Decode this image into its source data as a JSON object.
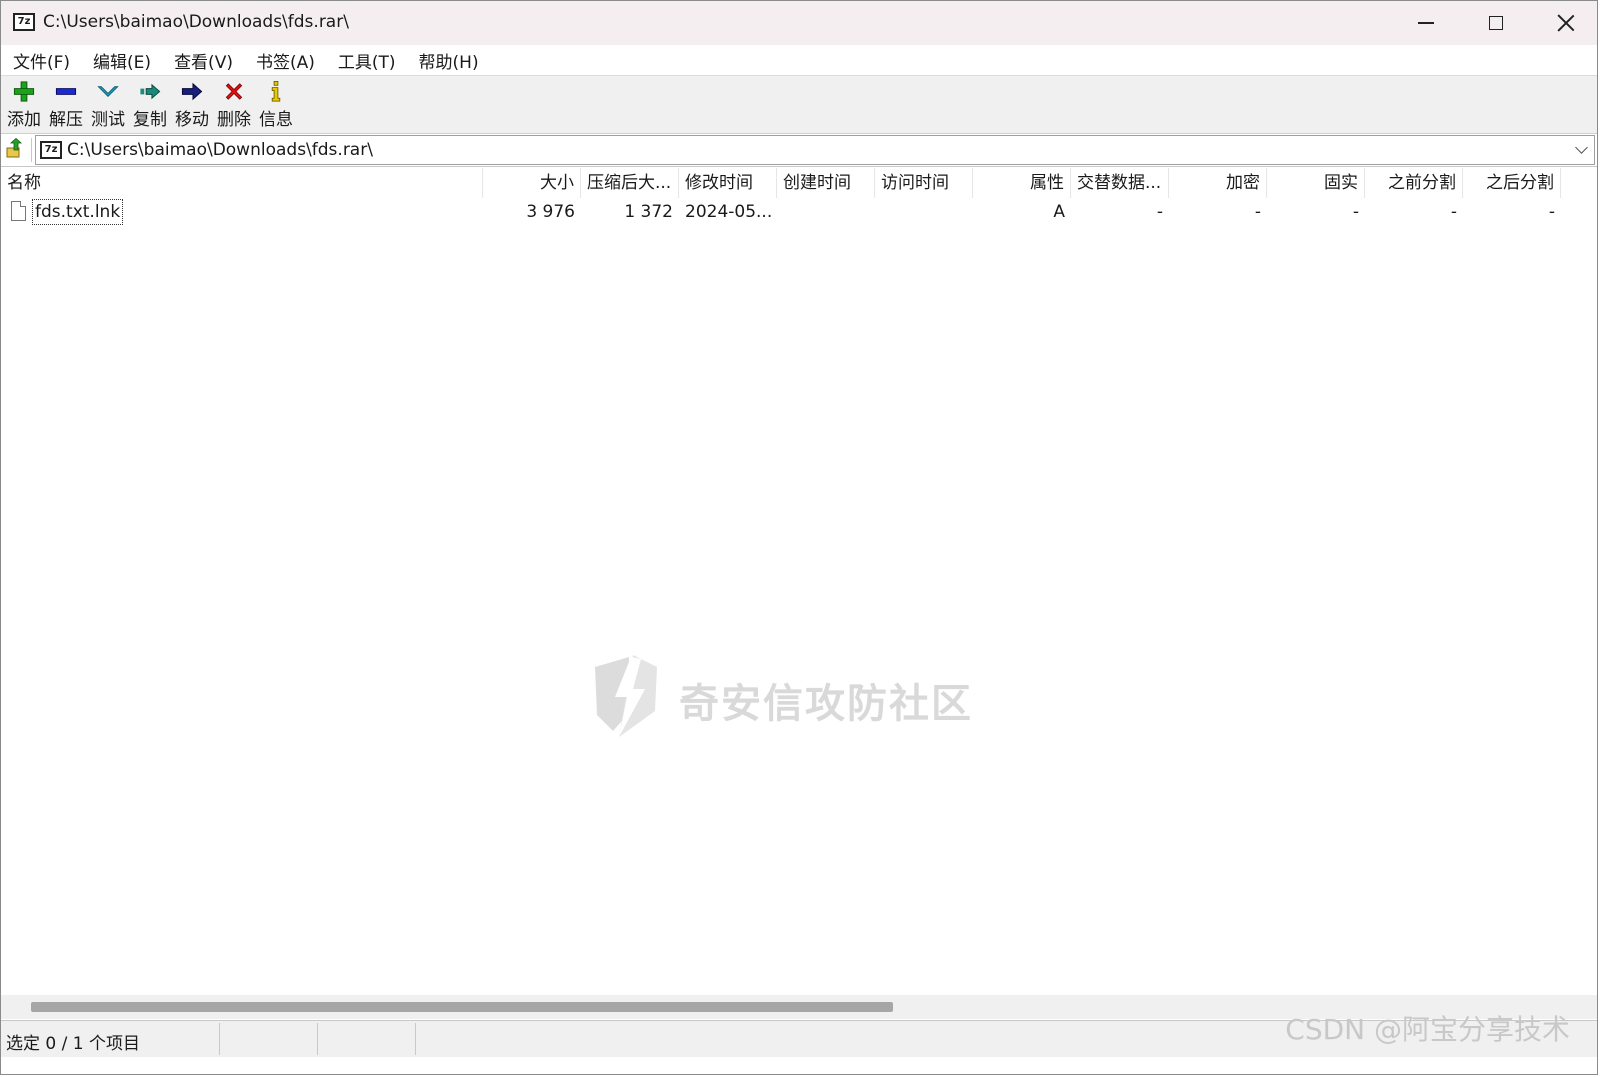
{
  "window": {
    "title": "C:\\Users\\baimao\\Downloads\\fds.rar\\",
    "app_icon_text": "7z"
  },
  "menu": [
    "文件(F)",
    "编辑(E)",
    "查看(V)",
    "书签(A)",
    "工具(T)",
    "帮助(H)"
  ],
  "toolbar": [
    {
      "label": "添加",
      "icon": "add-icon",
      "color": "#1ea21e"
    },
    {
      "label": "解压",
      "icon": "extract-icon",
      "color": "#1a2bd6"
    },
    {
      "label": "测试",
      "icon": "test-icon",
      "color": "#22a6c8"
    },
    {
      "label": "复制",
      "icon": "copy-icon",
      "color": "#1a8a7a"
    },
    {
      "label": "移动",
      "icon": "move-icon",
      "color": "#15207a"
    },
    {
      "label": "删除",
      "icon": "delete-icon",
      "color": "#e01010"
    },
    {
      "label": "信息",
      "icon": "info-icon",
      "color": "#c8a800"
    }
  ],
  "address": {
    "path": "C:\\Users\\baimao\\Downloads\\fds.rar\\"
  },
  "columns": [
    "名称",
    "大小",
    "压缩后大...",
    "修改时间",
    "创建时间",
    "访问时间",
    "属性",
    "交替数据...",
    "加密",
    "固实",
    "之前分割",
    "之后分割"
  ],
  "rows": [
    {
      "name": "fds.txt.lnk",
      "size": "3 976",
      "packed": "1 372",
      "modified": "2024-05...",
      "created": "",
      "accessed": "",
      "attributes": "A",
      "alt_streams": "-",
      "encrypted": "-",
      "solid": "-",
      "split_before": "-",
      "split_after": "-"
    }
  ],
  "watermark": "奇安信攻防社区",
  "status": {
    "selection": "选定 0 / 1 个项目"
  },
  "corner_watermark": "CSDN @阿宝分享技术"
}
